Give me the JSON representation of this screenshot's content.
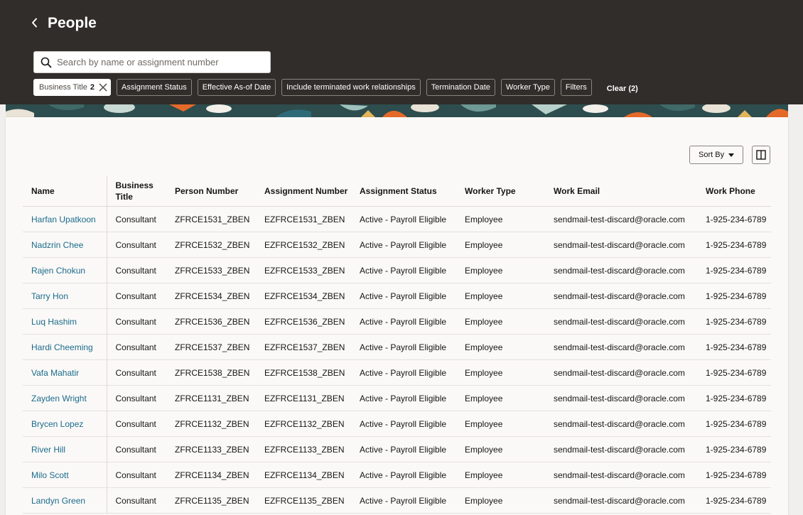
{
  "header": {
    "title": "People"
  },
  "search": {
    "placeholder": "Search by name or assignment number"
  },
  "filters": {
    "active": {
      "label": "Business Title",
      "count": "2"
    },
    "chips": [
      "Assignment Status",
      "Effective As-of Date",
      "Include terminated work relationships",
      "Termination Date",
      "Worker Type",
      "Filters"
    ],
    "clear_label": "Clear (2)"
  },
  "toolbar": {
    "sort_label": "Sort By"
  },
  "table": {
    "columns": [
      "Name",
      "Business Title",
      "Person Number",
      "Assignment Number",
      "Assignment Status",
      "Worker Type",
      "Work Email",
      "Work Phone"
    ],
    "rows": [
      [
        "Harfan Upatkoon",
        "Consultant",
        "ZFRCE1531_ZBEN",
        "EZFRCE1531_ZBEN",
        "Active - Payroll Eligible",
        "Employee",
        "sendmail-test-discard@oracle.com",
        "1-925-234-6789"
      ],
      [
        "Nadzrin Chee",
        "Consultant",
        "ZFRCE1532_ZBEN",
        "EZFRCE1532_ZBEN",
        "Active - Payroll Eligible",
        "Employee",
        "sendmail-test-discard@oracle.com",
        "1-925-234-6789"
      ],
      [
        "Rajen Chokun",
        "Consultant",
        "ZFRCE1533_ZBEN",
        "EZFRCE1533_ZBEN",
        "Active - Payroll Eligible",
        "Employee",
        "sendmail-test-discard@oracle.com",
        "1-925-234-6789"
      ],
      [
        "Tarry Hon",
        "Consultant",
        "ZFRCE1534_ZBEN",
        "EZFRCE1534_ZBEN",
        "Active - Payroll Eligible",
        "Employee",
        "sendmail-test-discard@oracle.com",
        "1-925-234-6789"
      ],
      [
        "Luq Hashim",
        "Consultant",
        "ZFRCE1536_ZBEN",
        "EZFRCE1536_ZBEN",
        "Active - Payroll Eligible",
        "Employee",
        "sendmail-test-discard@oracle.com",
        "1-925-234-6789"
      ],
      [
        "Hardi Cheeming",
        "Consultant",
        "ZFRCE1537_ZBEN",
        "EZFRCE1537_ZBEN",
        "Active - Payroll Eligible",
        "Employee",
        "sendmail-test-discard@oracle.com",
        "1-925-234-6789"
      ],
      [
        "Vafa Mahatir",
        "Consultant",
        "ZFRCE1538_ZBEN",
        "EZFRCE1538_ZBEN",
        "Active - Payroll Eligible",
        "Employee",
        "sendmail-test-discard@oracle.com",
        "1-925-234-6789"
      ],
      [
        "Zayden Wright",
        "Consultant",
        "ZFRCE1131_ZBEN",
        "EZFRCE1131_ZBEN",
        "Active - Payroll Eligible",
        "Employee",
        "sendmail-test-discard@oracle.com",
        "1-925-234-6789"
      ],
      [
        "Brycen Lopez",
        "Consultant",
        "ZFRCE1132_ZBEN",
        "EZFRCE1132_ZBEN",
        "Active - Payroll Eligible",
        "Employee",
        "sendmail-test-discard@oracle.com",
        "1-925-234-6789"
      ],
      [
        "River Hill",
        "Consultant",
        "ZFRCE1133_ZBEN",
        "EZFRCE1133_ZBEN",
        "Active - Payroll Eligible",
        "Employee",
        "sendmail-test-discard@oracle.com",
        "1-925-234-6789"
      ],
      [
        "Milo Scott",
        "Consultant",
        "ZFRCE1134_ZBEN",
        "EZFRCE1134_ZBEN",
        "Active - Payroll Eligible",
        "Employee",
        "sendmail-test-discard@oracle.com",
        "1-925-234-6789"
      ],
      [
        "Landyn Green",
        "Consultant",
        "ZFRCE1135_ZBEN",
        "EZFRCE1135_ZBEN",
        "Active - Payroll Eligible",
        "Employee",
        "sendmail-test-discard@oracle.com",
        "1-925-234-6789"
      ]
    ]
  },
  "colors": {
    "header_bg": "#312d2a",
    "link": "#1a6b8a",
    "page_bg": "#f1efed"
  }
}
